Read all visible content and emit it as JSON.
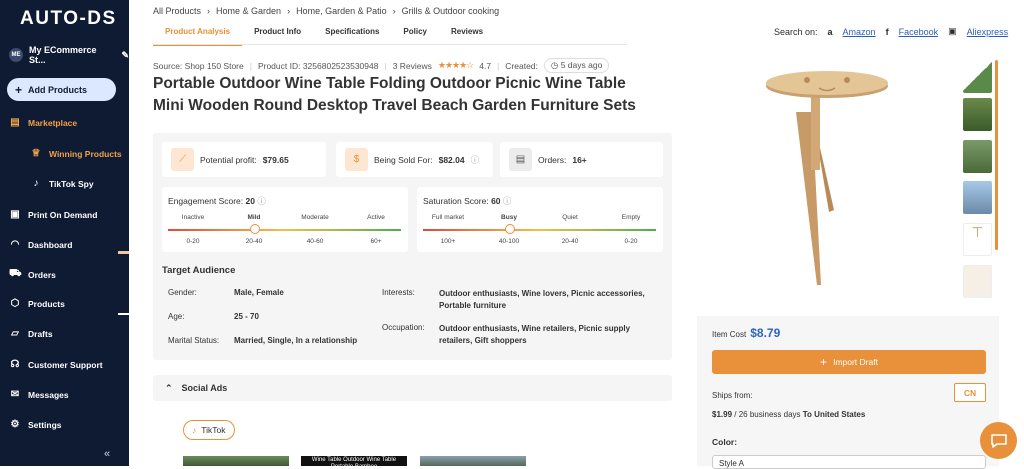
{
  "sidebar": {
    "logo": "AUTO-DS",
    "store_initials": "ME",
    "store_name": "My ECommerce St...",
    "add_products": "Add Products",
    "items": [
      {
        "label": "Marketplace",
        "icon": "store-icon"
      },
      {
        "label": "Winning Products",
        "icon": "trophy-icon"
      },
      {
        "label": "TikTok Spy",
        "icon": "tiktok-icon"
      },
      {
        "label": "Print On Demand",
        "icon": "shirt-icon"
      },
      {
        "label": "Dashboard",
        "icon": "gauge-icon"
      },
      {
        "label": "Orders",
        "icon": "truck-icon"
      },
      {
        "label": "Products",
        "icon": "box-icon"
      },
      {
        "label": "Drafts",
        "icon": "folder-icon"
      },
      {
        "label": "Customer Support",
        "icon": "headset-icon"
      },
      {
        "label": "Messages",
        "icon": "mail-icon"
      },
      {
        "label": "Settings",
        "icon": "gear-icon"
      }
    ]
  },
  "breadcrumb": [
    "All Products",
    "Home & Garden",
    "Home, Garden & Patio",
    "Grills & Outdoor cooking"
  ],
  "tabs": [
    "Product Analysis",
    "Product Info",
    "Specifications",
    "Policy",
    "Reviews"
  ],
  "search_on": {
    "label": "Search on:",
    "links": [
      "Amazon",
      "Facebook",
      "Aliexpress"
    ]
  },
  "meta": {
    "source": "Source: Shop 150 Store",
    "product_id": "Product ID: 3256802523530948",
    "reviews": "3 Reviews",
    "rating": "4.7",
    "created_label": "Created:",
    "created": "5 days ago"
  },
  "title": "Portable Outdoor Wine Table Folding Outdoor Picnic Wine Table Mini Wooden Round Desktop Travel Beach Garden Furniture Sets",
  "stats": {
    "profit_label": "Potential profit:",
    "profit": "$79.65",
    "sold_label": "Being Sold For:",
    "sold": "$82.04",
    "orders_label": "Orders:",
    "orders": "16+"
  },
  "engagement": {
    "label": "Engagement Score:",
    "value": "20",
    "levels": [
      "Inactive",
      "Mild",
      "Moderate",
      "Active"
    ],
    "ranges": [
      "0-20",
      "20-40",
      "40-60",
      "60+"
    ],
    "level_fraction": 0.375
  },
  "saturation": {
    "label": "Saturation Score:",
    "value": "60",
    "levels": [
      "Full market",
      "Busy",
      "Quiet",
      "Empty"
    ],
    "ranges": [
      "100+",
      "40-100",
      "20-40",
      "0-20"
    ],
    "level_fraction": 0.375
  },
  "audience": {
    "title": "Target Audience",
    "gender_label": "Gender:",
    "gender": "Male, Female",
    "age_label": "Age:",
    "age": "25 - 70",
    "marital_label": "Marital Status:",
    "marital": "Married, Single, In a relationship",
    "interests_label": "Interests:",
    "interests": "Outdoor enthusiasts, Wine lovers, Picnic accessories, Portable furniture",
    "occupation_label": "Occupation:",
    "occupation": "Outdoor enthusiasts, Wine retailers, Picnic supply retailers, Gift shoppers"
  },
  "social": {
    "title": "Social Ads",
    "tiktok": "TikTok",
    "video_caption": "Wine Table Outdoor Wine Table Portable Bamboo"
  },
  "purchase": {
    "cost_label": "Item Cost",
    "cost": "$8.79",
    "import": "Import Draft",
    "ships_from": "Ships from:",
    "country": "CN",
    "shipping_price": "$1.99",
    "shipping_days": "/ 26 business days",
    "shipping_to": "To United States",
    "color_label": "Color:",
    "color_value": "Style A"
  },
  "colors": {
    "accent": "#e8913a",
    "sidebar": "#0f1a33",
    "link": "#2a5fb3"
  }
}
